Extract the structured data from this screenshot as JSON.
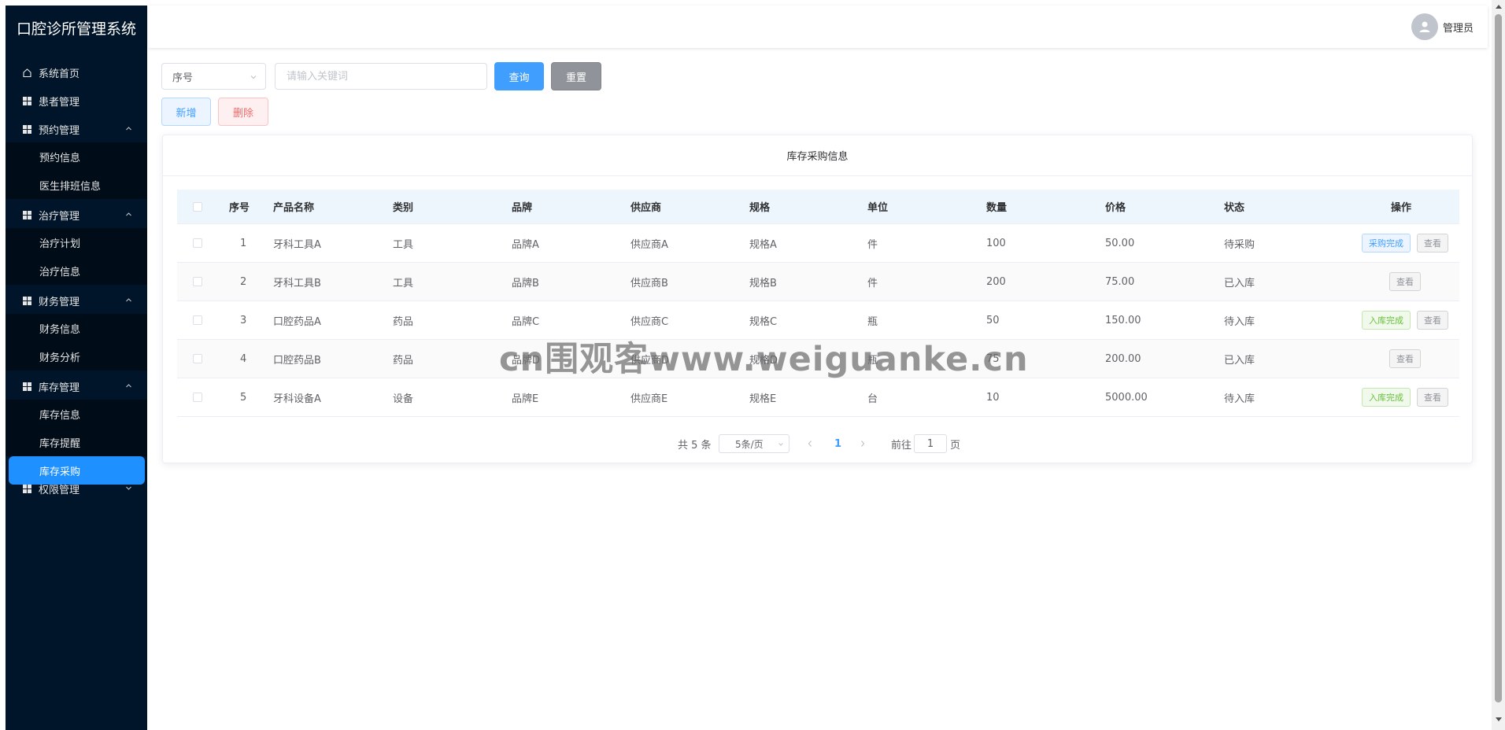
{
  "app_title": "口腔诊所管理系统",
  "sidebar": {
    "menu": [
      {
        "label": "系统首页",
        "icon": "home-icon"
      },
      {
        "label": "患者管理",
        "icon": "grid-icon"
      },
      {
        "label": "预约管理",
        "icon": "grid-icon",
        "expanded": true,
        "children": [
          "预约信息",
          "医生排班信息"
        ]
      },
      {
        "label": "治疗管理",
        "icon": "grid-icon",
        "expanded": true,
        "children": [
          "治疗计划",
          "治疗信息"
        ]
      },
      {
        "label": "财务管理",
        "icon": "grid-icon",
        "expanded": true,
        "children": [
          "财务信息",
          "财务分析"
        ]
      },
      {
        "label": "库存管理",
        "icon": "grid-icon",
        "expanded": true,
        "children": [
          "库存信息",
          "库存提醒",
          "库存采购"
        ]
      },
      {
        "label": "权限管理",
        "icon": "grid-icon",
        "expanded": false
      }
    ],
    "active_item": "库存采购",
    "active_color": "#1e90ff"
  },
  "header": {
    "user_name": "管理员",
    "avatar_icon": "user-icon"
  },
  "toolbar": {
    "search_field_selected": "序号",
    "search_placeholder": "请输入关键词",
    "search_value": "",
    "query_label": "查询",
    "reset_label": "重置",
    "add_label": "新增",
    "delete_label": "删除"
  },
  "table": {
    "title": "库存采购信息",
    "columns": [
      "序号",
      "产品名称",
      "类别",
      "品牌",
      "供应商",
      "规格",
      "单位",
      "数量",
      "价格",
      "状态",
      "操作"
    ],
    "rows": [
      {
        "id": "1",
        "name": "牙科工具A",
        "category": "工具",
        "brand": "品牌A",
        "supplier": "供应商A",
        "spec": "规格A",
        "unit": "件",
        "qty": "100",
        "price": "50.00",
        "status": "待采购",
        "actions": [
          {
            "label": "采购完成",
            "kind": "primary"
          },
          {
            "label": "查看",
            "kind": "info"
          }
        ]
      },
      {
        "id": "2",
        "name": "牙科工具B",
        "category": "工具",
        "brand": "品牌B",
        "supplier": "供应商B",
        "spec": "规格B",
        "unit": "件",
        "qty": "200",
        "price": "75.00",
        "status": "已入库",
        "actions": [
          {
            "label": "查看",
            "kind": "info"
          }
        ]
      },
      {
        "id": "3",
        "name": "口腔药品A",
        "category": "药品",
        "brand": "品牌C",
        "supplier": "供应商C",
        "spec": "规格C",
        "unit": "瓶",
        "qty": "50",
        "price": "150.00",
        "status": "待入库",
        "actions": [
          {
            "label": "入库完成",
            "kind": "success"
          },
          {
            "label": "查看",
            "kind": "info"
          }
        ]
      },
      {
        "id": "4",
        "name": "口腔药品B",
        "category": "药品",
        "brand": "品牌D",
        "supplier": "供应商D",
        "spec": "规格D",
        "unit": "瓶",
        "qty": "75",
        "price": "200.00",
        "status": "已入库",
        "actions": [
          {
            "label": "查看",
            "kind": "info"
          }
        ]
      },
      {
        "id": "5",
        "name": "牙科设备A",
        "category": "设备",
        "brand": "品牌E",
        "supplier": "供应商E",
        "spec": "规格E",
        "unit": "台",
        "qty": "10",
        "price": "5000.00",
        "status": "待入库",
        "actions": [
          {
            "label": "入库完成",
            "kind": "success"
          },
          {
            "label": "查看",
            "kind": "info"
          }
        ]
      }
    ]
  },
  "pagination": {
    "total_text": "共 5 条",
    "page_size": "5条/页",
    "current_page": "1",
    "goto_prefix": "前往",
    "goto_value": "1",
    "goto_suffix": "页"
  },
  "watermark": "cn围观客www.weiguanke.cn"
}
